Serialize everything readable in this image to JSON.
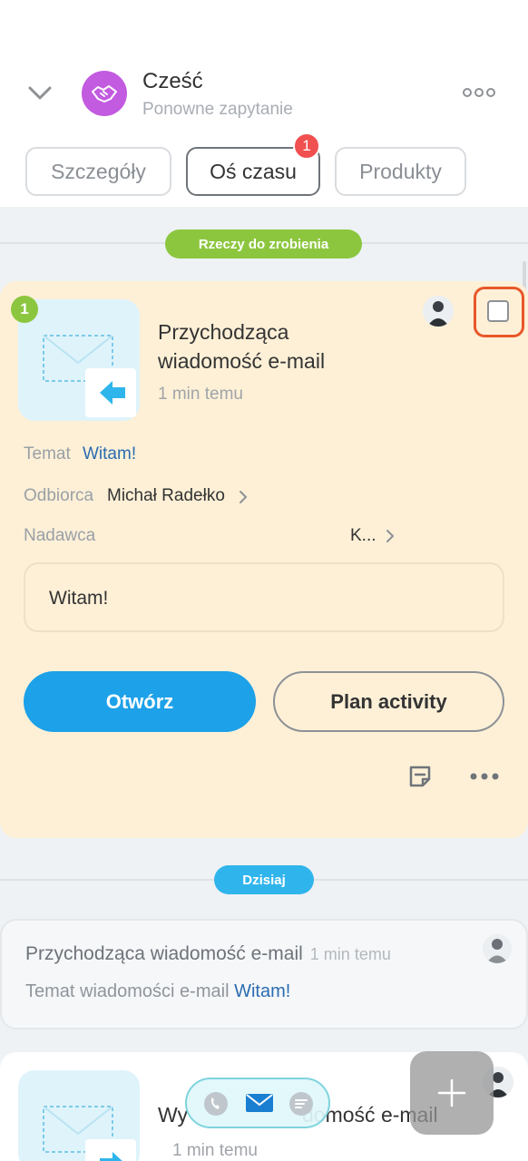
{
  "header": {
    "title": "Cześć",
    "subtitle": "Ponowne zapytanie"
  },
  "tabs": [
    {
      "label": "Szczegóły"
    },
    {
      "label": "Oś czasu",
      "badge": "1"
    },
    {
      "label": "Produkty"
    }
  ],
  "todo_section": {
    "pill": "Rzeczy do zrobienia",
    "badge": "1",
    "activity_title": "Przychodząca wiadomość e-mail",
    "time": "1 min temu",
    "subject_label": "Temat",
    "subject_value": "Witam!",
    "recipient_label": "Odbiorca",
    "recipient_value": "Michał Radełko",
    "sender_label": "Nadawca",
    "sender_value": "K...",
    "message": "Witam!",
    "open_button": "Otwórz",
    "plan_button": "Plan activity"
  },
  "today_section": {
    "pill": "Dzisiaj",
    "item_title": "Przychodząca wiadomość e-mail",
    "item_time": "1 min temu",
    "item_subject_label": "Temat wiadomości e-mail",
    "item_subject_value": "Witam!"
  },
  "card3": {
    "title_left": "Wy",
    "title_right": "domość e-mail",
    "time": "1 min temu"
  },
  "colors": {
    "accent_blue": "#1da1e8",
    "todo_green": "#8cc63f",
    "today_blue": "#2fb5ec",
    "badge_red": "#f05050",
    "todo_card_bg": "#fdf0d7",
    "highlight_orange": "#e8572a"
  }
}
